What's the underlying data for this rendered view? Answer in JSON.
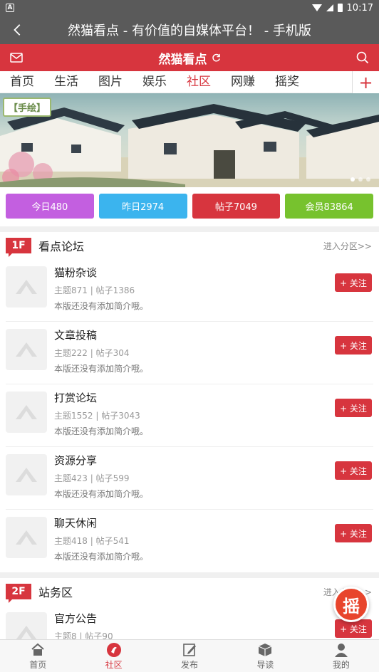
{
  "status_bar": {
    "time": "10:17"
  },
  "title_bar": {
    "title": "然猫看点 - 有价值的自媒体平台！ - 手机版"
  },
  "red_bar": {
    "brand": "然猫看点"
  },
  "nav_tabs": [
    {
      "label": "首页"
    },
    {
      "label": "生活"
    },
    {
      "label": "图片"
    },
    {
      "label": "娱乐"
    },
    {
      "label": "社区",
      "active": true
    },
    {
      "label": "网赚"
    },
    {
      "label": "摇奖"
    }
  ],
  "banner": {
    "stamp": "【手绘】"
  },
  "stats": [
    {
      "label": "今日480",
      "color": "#c35fe0"
    },
    {
      "label": "昨日2974",
      "color": "#3bb4ee"
    },
    {
      "label": "帖子7049",
      "color": "#d7353e"
    },
    {
      "label": "会员83864",
      "color": "#77c22e"
    }
  ],
  "sections": [
    {
      "floor": "1F",
      "title": "看点论坛",
      "more": "进入分区>>",
      "forums": [
        {
          "name": "猫粉杂谈",
          "meta": "主题871 | 帖子1386",
          "desc": "本版还没有添加简介哦。",
          "follow": "+ 关注"
        },
        {
          "name": "文章投稿",
          "meta": "主题222 | 帖子304",
          "desc": "本版还没有添加简介哦。",
          "follow": "+ 关注"
        },
        {
          "name": "打赏论坛",
          "meta": "主题1552 | 帖子3043",
          "desc": "本版还没有添加简介哦。",
          "follow": "+ 关注"
        },
        {
          "name": "资源分享",
          "meta": "主题423 | 帖子599",
          "desc": "本版还没有添加简介哦。",
          "follow": "+ 关注"
        },
        {
          "name": "聊天休闲",
          "meta": "主题418 | 帖子541",
          "desc": "本版还没有添加简介哦。",
          "follow": "+ 关注"
        }
      ]
    },
    {
      "floor": "2F",
      "title": "站务区",
      "more": "进入分区>>",
      "forums": [
        {
          "name": "官方公告",
          "meta": "主题8 | 帖子90",
          "desc": "",
          "follow": "+ 关注"
        }
      ]
    }
  ],
  "shake_button": "摇",
  "bottom_nav": [
    {
      "label": "首页",
      "icon": "home-icon"
    },
    {
      "label": "社区",
      "icon": "community-icon",
      "active": true
    },
    {
      "label": "发布",
      "icon": "edit-icon"
    },
    {
      "label": "导读",
      "icon": "box-icon"
    },
    {
      "label": "我的",
      "icon": "user-icon"
    }
  ],
  "colors": {
    "accent": "#d7353e",
    "titlebar": "#5a5a5a"
  }
}
